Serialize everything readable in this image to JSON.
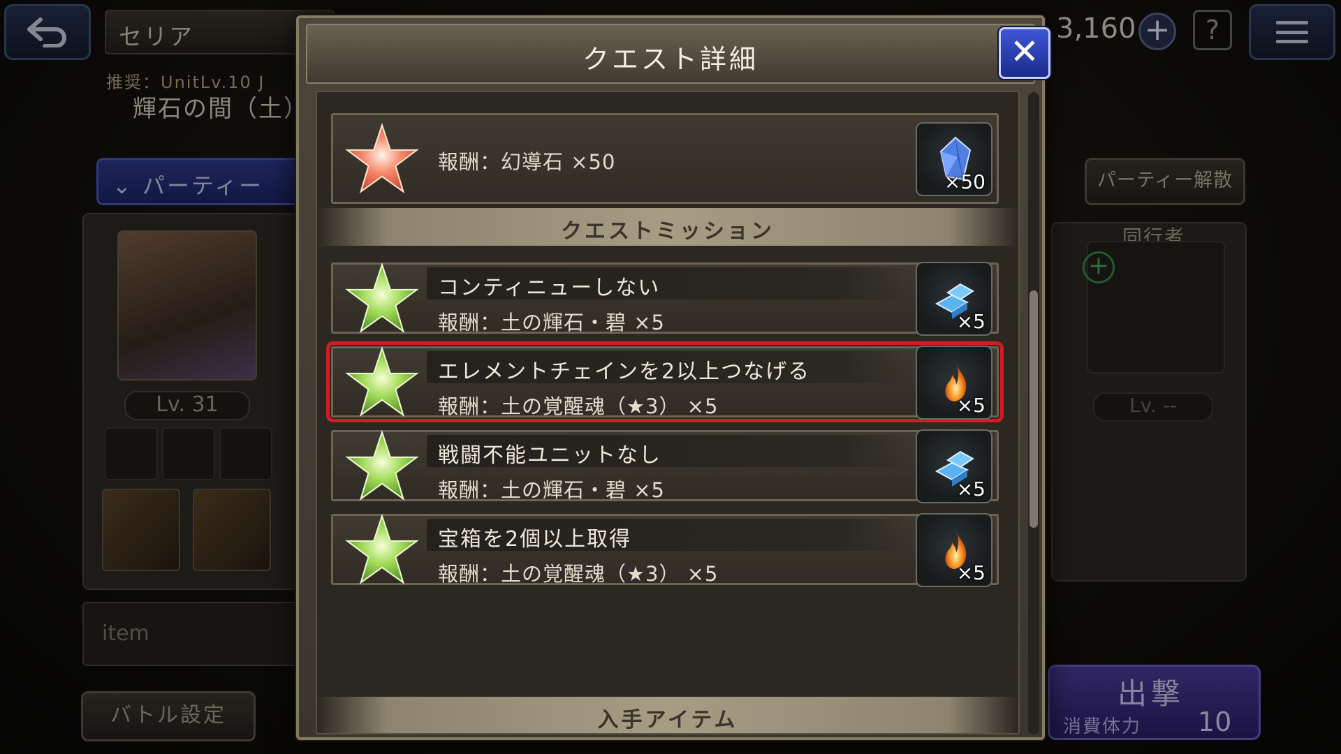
{
  "background": {
    "area_name": "セリア",
    "recommend": "推奨：UnitLv.10 J",
    "stage_name": "輝石の間（土）",
    "stone_count": "3,160",
    "help_glyph": "?",
    "party_tab": "パーティー",
    "level": "Lv. 31",
    "item_label": "item",
    "battle_settings": "バトル設定",
    "disband_button": "パーティー解散",
    "companion_label": "同行者",
    "companion_level": "Lv. --",
    "sortie_label": "出撃",
    "stamina_label": "消費体力",
    "stamina_value": "10"
  },
  "modal": {
    "title": "クエスト詳細",
    "close_glyph": "✕",
    "first_clear": {
      "reward": "報酬：幻導石 ×50",
      "count": "×50"
    },
    "section_missions": "クエストミッション",
    "missions": [
      {
        "title": "コンティニューしない",
        "reward": "報酬：土の輝石・碧 ×5",
        "count": "×5",
        "icon": "crystal-icon"
      },
      {
        "title": "エレメントチェインを2以上つなげる",
        "reward": "報酬：土の覚醒魂（★3） ×5",
        "count": "×5",
        "icon": "flame-soul-icon"
      },
      {
        "title": "戦闘不能ユニットなし",
        "reward": "報酬：土の輝石・碧 ×5",
        "count": "×5",
        "icon": "crystal-icon"
      },
      {
        "title": "宝箱を2個以上取得",
        "reward": "報酬：土の覚醒魂（★3） ×5",
        "count": "×5",
        "icon": "flame-soul-icon"
      }
    ],
    "section_items": "入手アイテム"
  },
  "colors": {
    "highlight": "#d41c23",
    "close_button": "#2f45c4",
    "first_clear_star": "#f0785a",
    "mission_star": "#8fd14a"
  }
}
